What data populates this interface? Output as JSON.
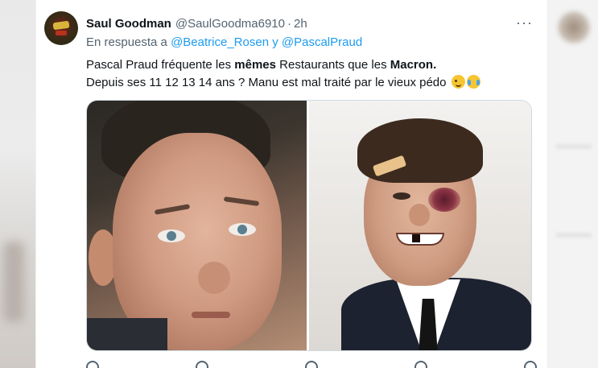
{
  "tweet": {
    "author_name": "Saul Goodman",
    "author_handle": "@SaulGoodma6910",
    "separator": "·",
    "time": "2h",
    "more_label": "···",
    "reply_prefix": "En respuesta a",
    "reply_mention_1": "@Beatrice_Rosen",
    "reply_and": "y",
    "reply_mention_2": "@PascalPraud",
    "text_line1_a": "Pascal Praud fréquente les ",
    "text_line1_bold1": "mêmes",
    "text_line1_b": " Restaurants que les ",
    "text_line1_bold2": "Macron.",
    "text_line2": "Depuis ses 11 12 13 14 ans ? Manu est mal traité par le vieux pédo",
    "emojis": [
      "wink-emoji",
      "joy-emoji"
    ]
  },
  "media": {
    "images": [
      "photo-left",
      "photo-right"
    ]
  },
  "colors": {
    "link": "#1d9bf0",
    "text": "#0f1419",
    "secondary": "#536471"
  }
}
